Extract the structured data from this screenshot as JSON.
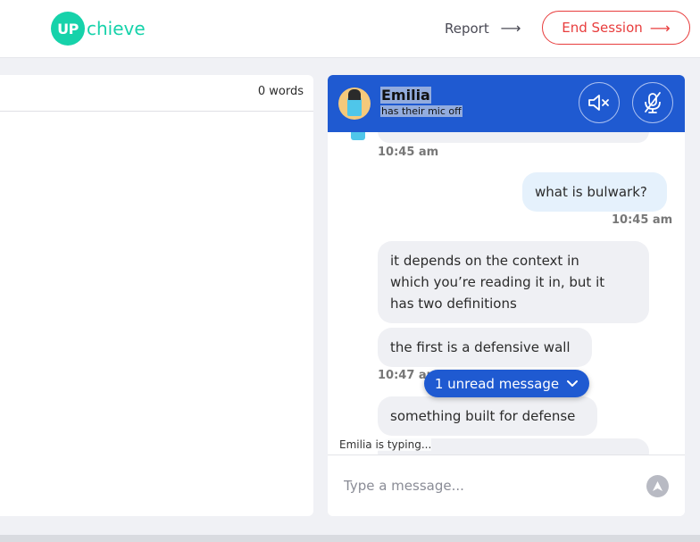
{
  "header": {
    "logo_mark": "UP",
    "logo_text": "chieve",
    "report_label": "Report",
    "end_session_label": "End Session",
    "arrow": "⟶"
  },
  "editor": {
    "word_count": "0 words"
  },
  "chat": {
    "partner_name": "Emilia",
    "partner_status": "has their mic off",
    "messages": [
      {
        "time": "10:45 am"
      },
      {
        "text": "what is bulwark?",
        "time": "10:45 am"
      },
      {
        "line1": "it depends on the context in",
        "line2": "which you’re reading it in, but it",
        "line3": "has two definitions"
      },
      {
        "text": "the first is a defensive wall",
        "time": "10:47 am"
      },
      {
        "text": "something built for defense"
      }
    ],
    "unread_label": "1 unread message",
    "typing_text": "Emilia is typing...",
    "input_placeholder": "Type a message..."
  },
  "colors": {
    "brand": "#16d2aa",
    "chat_header": "#1f5ad1",
    "end_session": "#e83d3d"
  }
}
